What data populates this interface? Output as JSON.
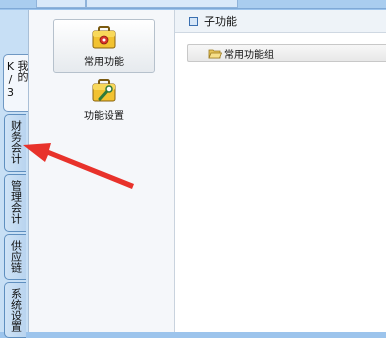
{
  "vertical_tabs": [
    {
      "label": "我的K/3",
      "active": true
    },
    {
      "label": "财务会计",
      "active": false
    },
    {
      "label": "管理会计",
      "active": false
    },
    {
      "label": "供应链",
      "active": false
    },
    {
      "label": "系统设置",
      "active": false
    }
  ],
  "nav": {
    "common_functions": {
      "label": "常用功能",
      "icon": "briefcase-icon",
      "selected": true
    },
    "function_settings": {
      "label": "功能设置",
      "icon": "briefcase-wrench-icon",
      "selected": false
    }
  },
  "content": {
    "header_title": "子功能",
    "group": {
      "label": "常用功能组",
      "icon": "folder-open-icon"
    }
  },
  "annotation": {
    "type": "red-arrow",
    "color": "#e8322b"
  }
}
